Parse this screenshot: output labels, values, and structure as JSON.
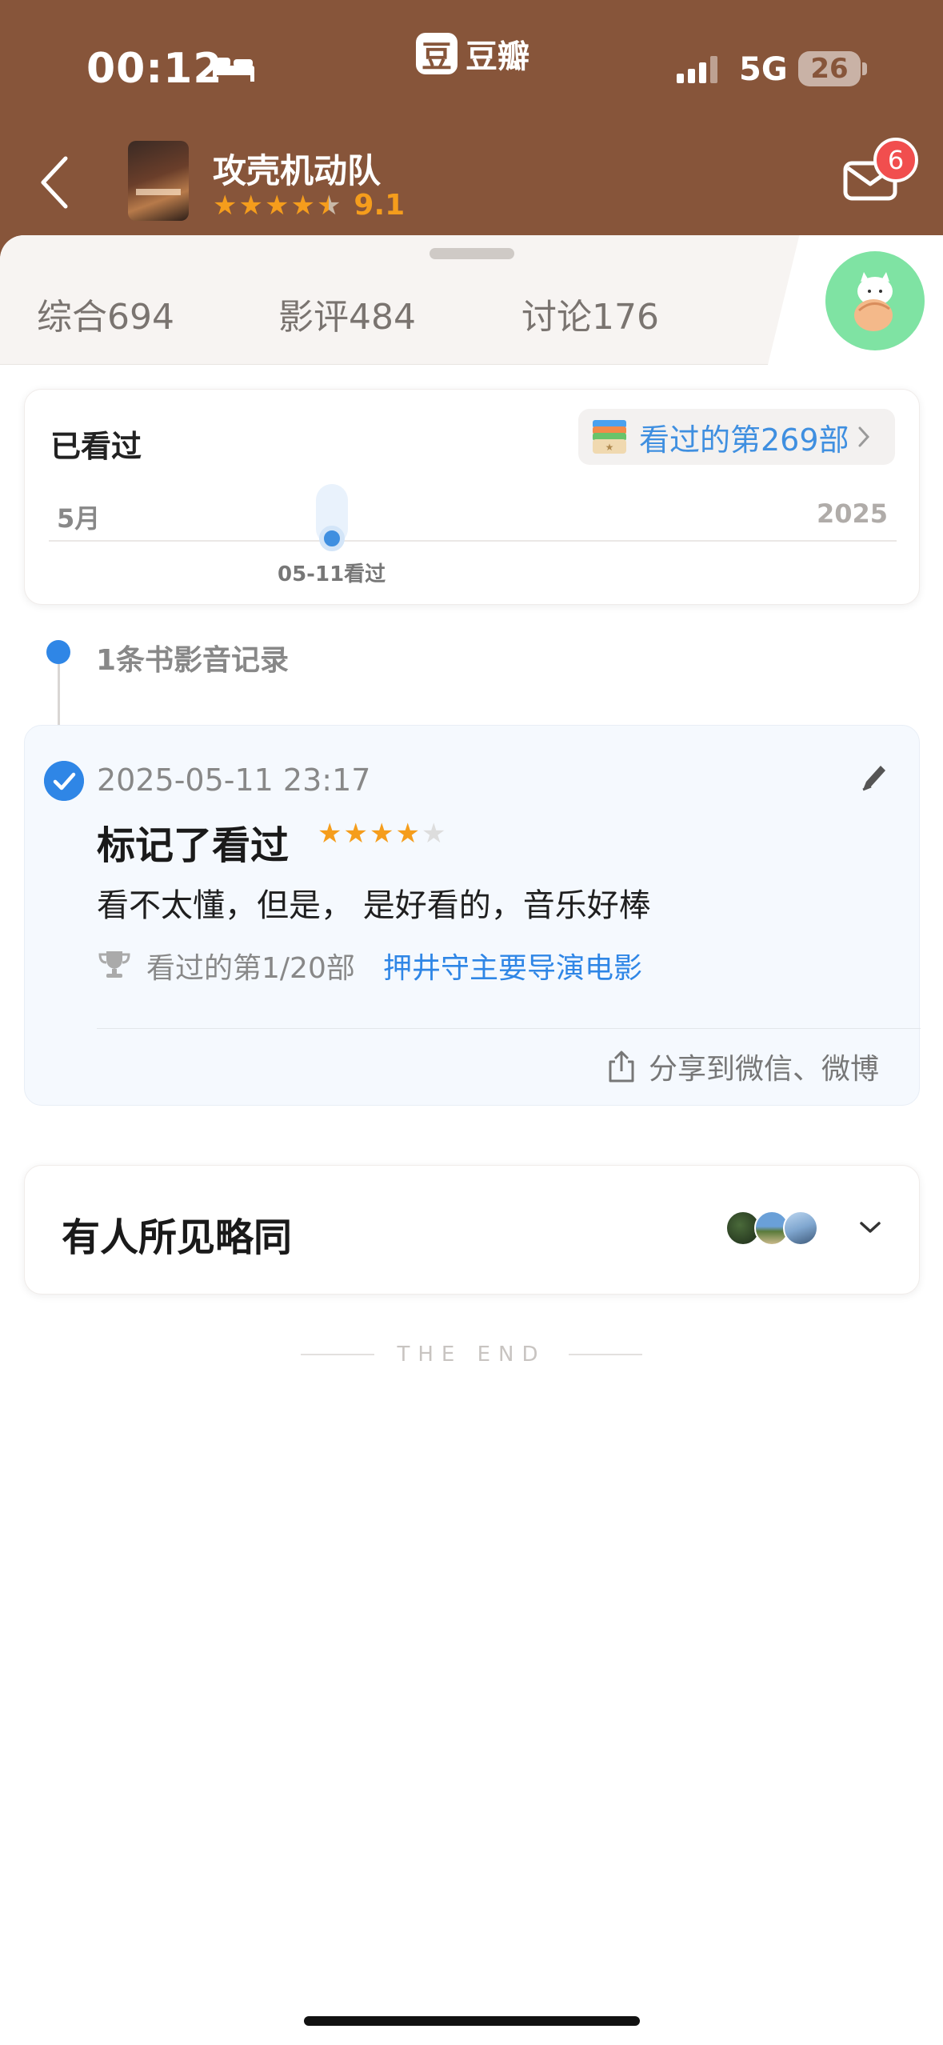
{
  "status_bar": {
    "time": "00:12",
    "network": "5G",
    "battery": "26"
  },
  "app": {
    "logo_char": "豆",
    "name": "豆瓣"
  },
  "movie": {
    "title": "攻壳机动队",
    "rating": "9.1",
    "stars": 4.5
  },
  "notifications": {
    "count": "6"
  },
  "tabs": [
    {
      "label": "综合694"
    },
    {
      "label": "影评484"
    },
    {
      "label": "讨论176"
    }
  ],
  "watched": {
    "title": "已看过",
    "count_text": "看过的第269部",
    "month": "5月",
    "year": "2025",
    "date_label": "05-11看过"
  },
  "records": {
    "label": "1条书影音记录",
    "items": [
      {
        "time": "2025-05-11 23:17",
        "action": "标记了看过",
        "stars": 4,
        "comment": "看不太懂，但是， 是好看的，音乐好棒",
        "rank_text": "看过的第1/20部",
        "rank_link": "押井守主要导演电影",
        "share_text": "分享到微信、微博"
      }
    ]
  },
  "similar": {
    "title": "有人所见略同"
  },
  "footer": {
    "end_text": "THE END"
  },
  "colors": {
    "header_bg": "#87553a",
    "accent_blue": "#2f86e6",
    "star_orange": "#f59d1c",
    "badge_red": "#f14e4e"
  },
  "icons": [
    "back-icon",
    "bed-icon",
    "signal-icon",
    "mail-icon",
    "box-icon",
    "chevron-right-icon",
    "check-icon",
    "edit-icon",
    "trophy-icon",
    "share-icon",
    "chevron-down-icon"
  ]
}
